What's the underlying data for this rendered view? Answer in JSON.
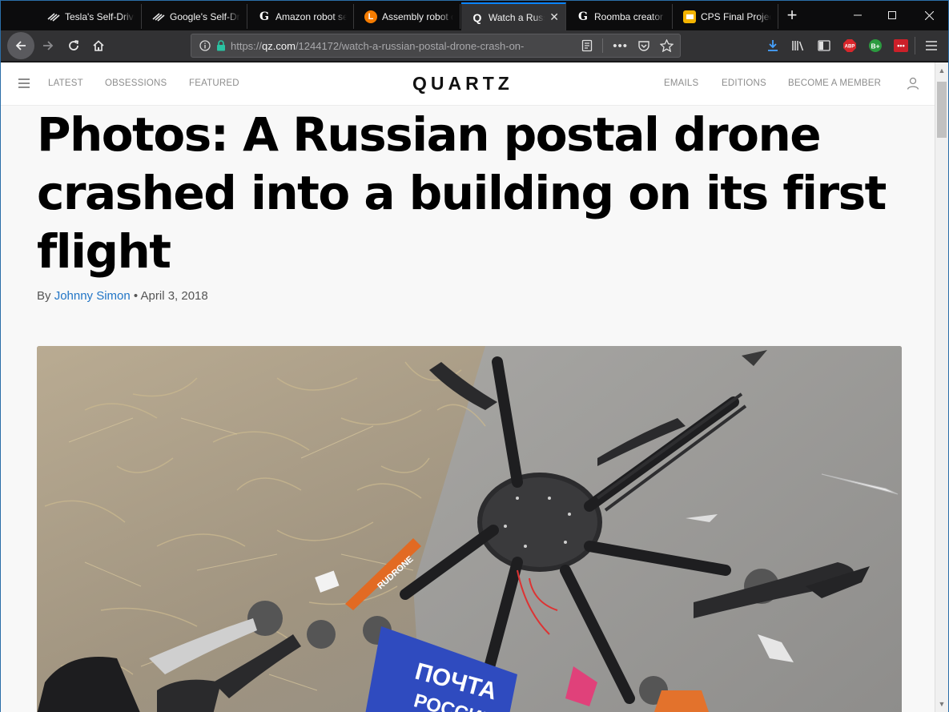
{
  "browser": {
    "tabs": [
      {
        "title": "Tesla's Self-Driving",
        "favicon": "tesla-icon",
        "active": false
      },
      {
        "title": "Google's Self-Driving",
        "favicon": "tesla-icon",
        "active": false
      },
      {
        "title": "Amazon robot se",
        "favicon": "g-letter-icon",
        "active": false
      },
      {
        "title": "Assembly robot c",
        "favicon": "l-letter-icon",
        "active": false
      },
      {
        "title": "Watch a Russ",
        "favicon": "q-letter-icon",
        "active": true
      },
      {
        "title": "Roomba creator r",
        "favicon": "g-letter-icon",
        "active": false
      },
      {
        "title": "CPS Final Project",
        "favicon": "slides-icon",
        "active": false
      }
    ],
    "url_prefix": "https://",
    "url_host": "qz.com",
    "url_path": "/1244172/watch-a-russian-postal-drone-crash-on-",
    "icons": {
      "abp_badge": "ABP",
      "extension_badge": "B+",
      "lastpass_badge": "•••"
    },
    "colors": {
      "accent": "#0a84ff",
      "tabstrip": "#0c0c0d",
      "toolbar": "#323234"
    }
  },
  "site": {
    "nav_left": [
      "LATEST",
      "OBSESSIONS",
      "FEATURED"
    ],
    "logo": "QUARTZ",
    "nav_right": [
      "EMAILS",
      "EDITIONS",
      "BECOME A MEMBER"
    ]
  },
  "article": {
    "headline": "Photos: A Russian postal drone crashed into a building on its first flight",
    "by_prefix": "By ",
    "author": "Johnny Simon",
    "separator": " • ",
    "date": "April 3, 2018",
    "hero_text": [
      "RUDRONE",
      "ПОЧТА",
      "РОССИИ"
    ]
  }
}
